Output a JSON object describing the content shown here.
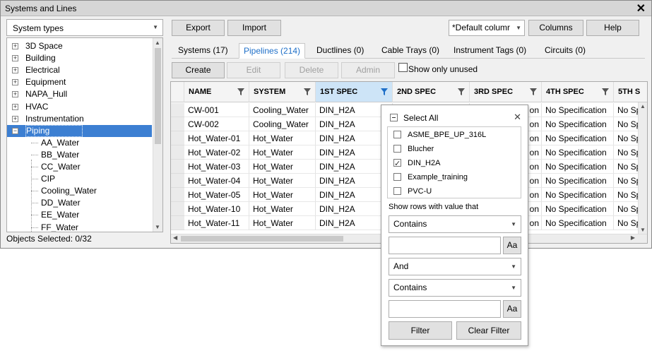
{
  "window": {
    "title": "Systems and Lines"
  },
  "left": {
    "combo_value": "System types",
    "tree": [
      {
        "label": "3D Space",
        "expander": "+"
      },
      {
        "label": "Building",
        "expander": "+"
      },
      {
        "label": "Electrical",
        "expander": "+"
      },
      {
        "label": "Equipment",
        "expander": "+"
      },
      {
        "label": "NAPA_Hull",
        "expander": "+"
      },
      {
        "label": "HVAC",
        "expander": "+"
      },
      {
        "label": "Instrumentation",
        "expander": "+"
      },
      {
        "label": "Piping",
        "expander": "−"
      }
    ],
    "children": [
      "AA_Water",
      "BB_Water",
      "CC_Water",
      "CIP",
      "Cooling_Water",
      "DD_Water",
      "EE_Water",
      "FF_Water"
    ],
    "status": "Objects Selected: 0/32"
  },
  "toolbar": {
    "export": "Export",
    "import": "Import",
    "columns_preset": "*Default columr",
    "columns": "Columns",
    "help": "Help",
    "create": "Create",
    "edit": "Edit",
    "delete": "Delete",
    "admin": "Admin",
    "show_unused": "Show only unused"
  },
  "tabs": [
    "Systems (17)",
    "Pipelines (214)",
    "Ductlines (0)",
    "Cable Trays (0)",
    "Instrument Tags (0)",
    "Circuits (0)"
  ],
  "grid": {
    "headers": [
      "NAME",
      "SYSTEM",
      "1ST SPEC",
      "2ND SPEC",
      "3RD SPEC",
      "4TH SPEC",
      "5TH S"
    ],
    "rows": [
      {
        "name": "CW-001",
        "system": "Cooling_Water",
        "spec1": "DIN_H2A",
        "spec3": "on",
        "spec4": "No Specification",
        "spec5": "No Sp"
      },
      {
        "name": "CW-002",
        "system": "Cooling_Water",
        "spec1": "DIN_H2A",
        "spec3": "on",
        "spec4": "No Specification",
        "spec5": "No Sp"
      },
      {
        "name": "Hot_Water-01",
        "system": "Hot_Water",
        "spec1": "DIN_H2A",
        "spec3": "on",
        "spec4": "No Specification",
        "spec5": "No Sp"
      },
      {
        "name": "Hot_Water-02",
        "system": "Hot_Water",
        "spec1": "DIN_H2A",
        "spec3": "on",
        "spec4": "No Specification",
        "spec5": "No Sp"
      },
      {
        "name": "Hot_Water-03",
        "system": "Hot_Water",
        "spec1": "DIN_H2A",
        "spec3": "on",
        "spec4": "No Specification",
        "spec5": "No Sp"
      },
      {
        "name": "Hot_Water-04",
        "system": "Hot_Water",
        "spec1": "DIN_H2A",
        "spec3": "on",
        "spec4": "No Specification",
        "spec5": "No Sp"
      },
      {
        "name": "Hot_Water-05",
        "system": "Hot_Water",
        "spec1": "DIN_H2A",
        "spec3": "on",
        "spec4": "No Specification",
        "spec5": "No Sp"
      },
      {
        "name": "Hot_Water-10",
        "system": "Hot_Water",
        "spec1": "DIN_H2A",
        "spec3": "on",
        "spec4": "No Specification",
        "spec5": "No Sp"
      },
      {
        "name": "Hot_Water-11",
        "system": "Hot_Water",
        "spec1": "DIN_H2A",
        "spec3": "on",
        "spec4": "No Specification",
        "spec5": "No Sp"
      }
    ]
  },
  "filter": {
    "select_all": "Select All",
    "options": [
      {
        "label": "ASME_BPE_UP_316L",
        "checked": false
      },
      {
        "label": "Blucher",
        "checked": false
      },
      {
        "label": "DIN_H2A",
        "checked": true
      },
      {
        "label": "Example_training",
        "checked": false
      },
      {
        "label": "PVC-U",
        "checked": false
      }
    ],
    "show_rows": "Show rows with value that",
    "op1": "Contains",
    "value1": "",
    "case1": "Aa",
    "combine": "And",
    "op2": "Contains",
    "value2": "",
    "case2": "Aa",
    "filter_btn": "Filter",
    "clear_btn": "Clear Filter"
  },
  "colors": {
    "accent": "#1e6fc8",
    "selection": "#3c7fd2",
    "active_header": "#cde4f7"
  },
  "icons": {
    "close": "close-icon",
    "funnel": "filter-funnel-icon",
    "check": "check-icon"
  }
}
